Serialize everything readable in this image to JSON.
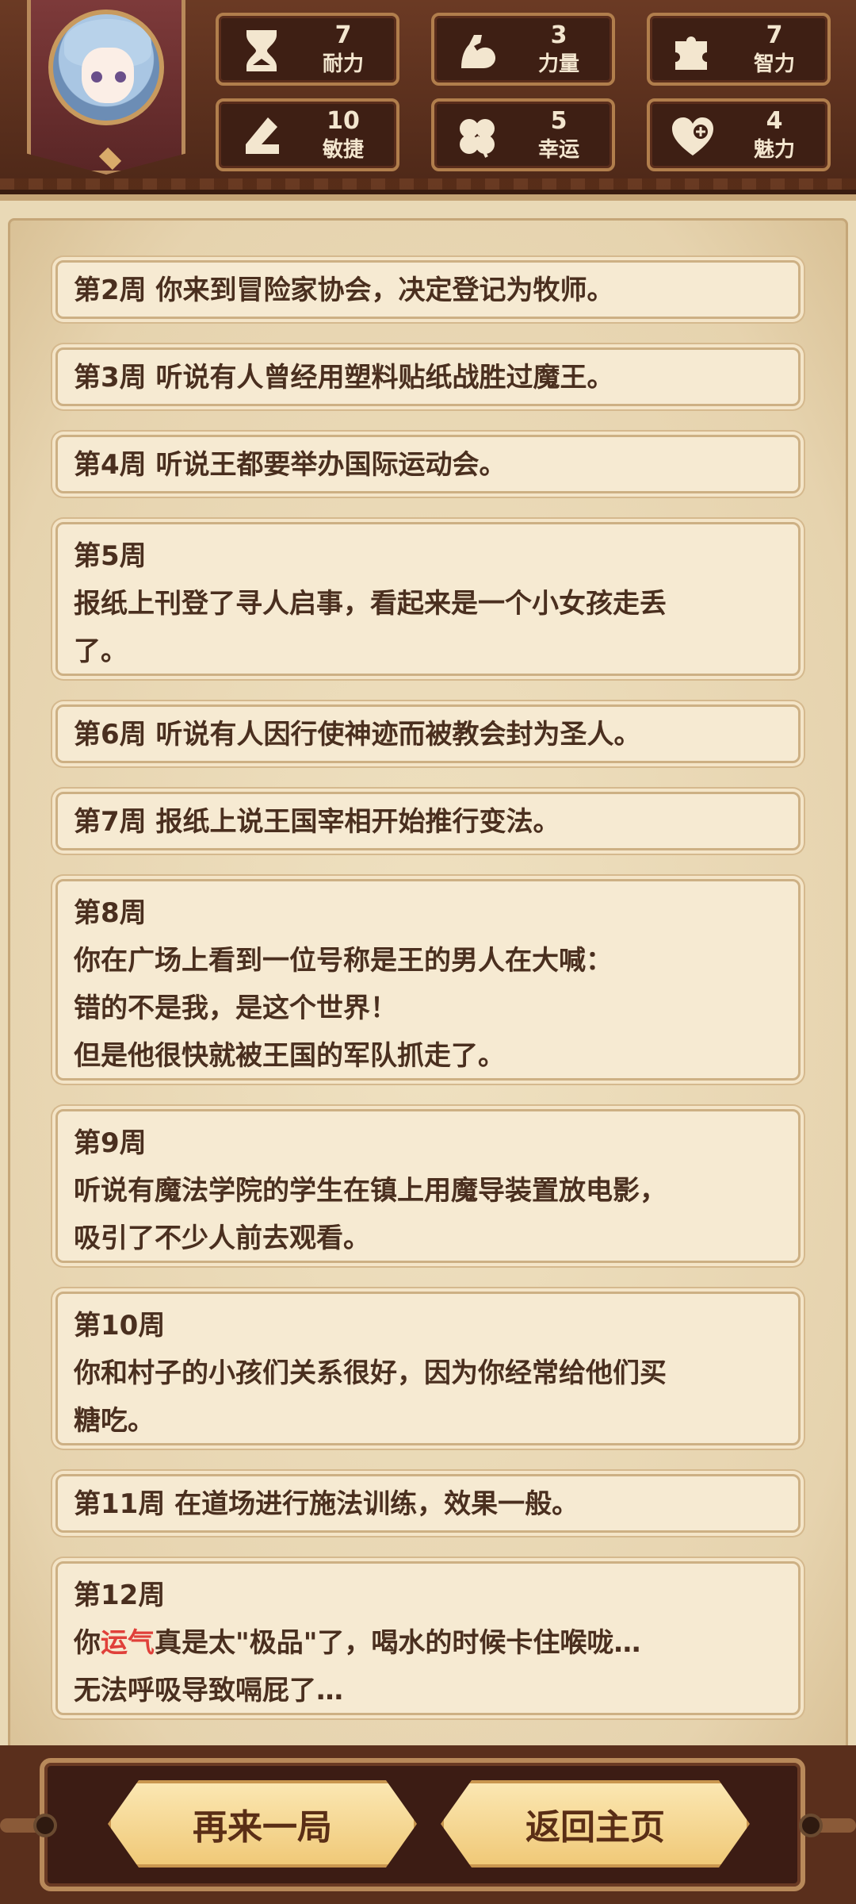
{
  "stats": [
    {
      "value": "7",
      "label": "耐力",
      "icon": "hourglass-icon"
    },
    {
      "value": "3",
      "label": "力量",
      "icon": "bicep-icon"
    },
    {
      "value": "7",
      "label": "智力",
      "icon": "puzzle-icon"
    },
    {
      "value": "10",
      "label": "敏捷",
      "icon": "boot-icon"
    },
    {
      "value": "5",
      "label": "幸运",
      "icon": "clover-icon"
    },
    {
      "value": "4",
      "label": "魅力",
      "icon": "heart-plus-icon"
    }
  ],
  "entries": [
    {
      "lines": [
        "第2周 你来到冒险家协会，决定登记为牧师。"
      ]
    },
    {
      "lines": [
        "第3周 听说有人曾经用塑料贴纸战胜过魔王。"
      ]
    },
    {
      "lines": [
        "第4周 听说王都要举办国际运动会。"
      ]
    },
    {
      "lines": [
        "第5周",
        "报纸上刊登了寻人启事，看起来是一个小女孩走丢",
        "了。"
      ]
    },
    {
      "lines": [
        "第6周 听说有人因行使神迹而被教会封为圣人。"
      ]
    },
    {
      "lines": [
        "第7周 报纸上说王国宰相开始推行变法。"
      ]
    },
    {
      "lines": [
        "第8周",
        "你在广场上看到一位号称是王的男人在大喊：",
        "错的不是我，是这个世界！",
        "但是他很快就被王国的军队抓走了。"
      ]
    },
    {
      "lines": [
        "第9周",
        "听说有魔法学院的学生在镇上用魔导装置放电影，",
        "吸引了不少人前去观看。"
      ]
    },
    {
      "lines": [
        "第10周",
        "你和村子的小孩们关系很好，因为你经常给他们买",
        "糖吃。"
      ]
    },
    {
      "lines": [
        "第11周 在道场进行施法训练，效果一般。"
      ]
    },
    {
      "lines": [
        "第12周"
      ],
      "rich_line": {
        "before": "你",
        "highlight": "运气",
        "after": "真是太\"极品\"了，喝水的时候卡住喉咙…"
      },
      "last_line": "无法呼吸导致嗝屁了…"
    }
  ],
  "buttons": {
    "replay": "再来一局",
    "home": "返回主页"
  },
  "colors": {
    "highlight": "#e0403a",
    "text": "#4a2f1f",
    "button_bg": "#f0c978"
  }
}
